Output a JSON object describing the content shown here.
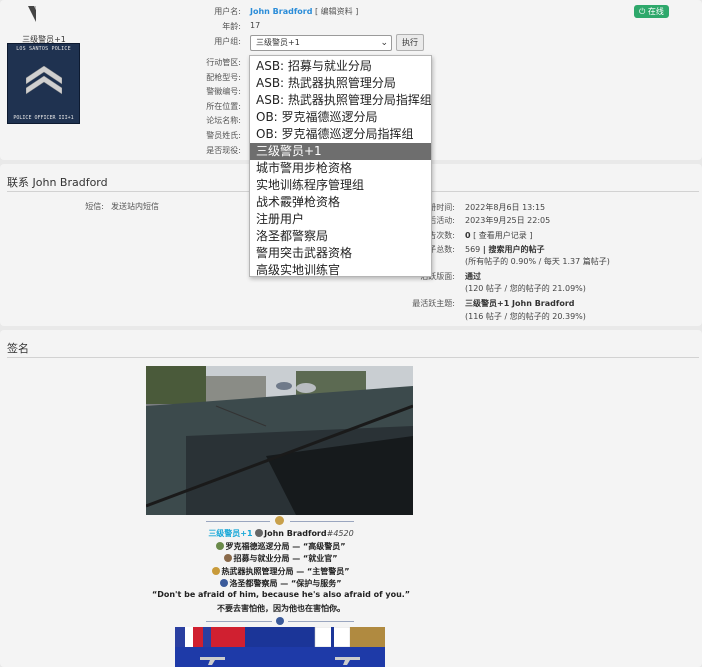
{
  "profile": {
    "avatar_rank": "三级警员+1",
    "avatar_badge_title": "LOS SANTOS POLICE",
    "avatar_badge_foot": "POLICE OFFICER III+1",
    "username_label": "用户名:",
    "username": "John Bradford",
    "edit_profile": "[ 编辑资料 ]",
    "age_label": "年龄:",
    "age": "17",
    "group_label": "用户组:",
    "group_selected": "三级警员+1",
    "execute_button": "执行",
    "online_status": "在线",
    "row_labels": [
      "行动管区:",
      "配枪型号:",
      "警徽编号:",
      "所在位置:",
      "论坛名称:",
      "警员姓氏:",
      "是否现役:"
    ]
  },
  "group_dropdown": {
    "options": [
      "ASB: 招募与就业分局",
      "ASB: 热武器执照管理分局",
      "ASB: 热武器执照管理分局指挥组",
      "OB: 罗克福德巡逻分局",
      "OB: 罗克福德巡逻分局指挥组",
      "三级警员+1",
      "城市警用步枪资格",
      "实地训练程序管理组",
      "战术霰弹枪资格",
      "注册用户",
      "洛圣都警察局",
      "警用突击武器资格",
      "高级实地训练官"
    ],
    "selected_index": 5
  },
  "contact": {
    "title": "联系 John Bradford",
    "pm_label": "短信:",
    "pm_link": "发送站内短信",
    "register_label": "册时间:",
    "register_value": "2022年8月6日 13:15",
    "last_active_label": "后活动:",
    "last_active_value": "2023年9月25日 22:05",
    "warnings_label": "告次数:",
    "warnings_count": "0",
    "warnings_link": "[ 查看用户记录 ]",
    "posts_label": "子总数:",
    "posts_count": "569",
    "posts_search": "| 搜索用户的帖子",
    "posts_stats": "(所有帖子的 0.90% / 每天 1.37 篇帖子)",
    "active_forum_label": "活跃版面:",
    "active_forum_value": "通过",
    "active_forum_stats": "(120 帖子 / 您的帖子的 21.09%)",
    "active_topic_label": "最活跃主题:",
    "active_topic_value": "三级警员+1 John Bradford",
    "active_topic_stats": "(116 帖子 / 您的帖子的 20.39%)"
  },
  "signature": {
    "title": "签名",
    "rank": "三级警员+1",
    "name": "John Bradford",
    "tag": "#4520",
    "line1": "罗克福德巡逻分局 — “高级警员”",
    "line2": "招募与就业分局 — “就业官”",
    "line3": "热武器执照管理分局 — “主管警员”",
    "line4": "洛圣都警察局 — “保护与服务”",
    "quote_en": "“Don't be afraid of him, because he's also afraid of you.”",
    "quote_cn": "不要去害怕他，因为他也在害怕你。"
  },
  "colors": {
    "link_blue": "#2a8cd8",
    "online_green": "#2ea86b",
    "rank_cyan": "#19a8d8",
    "selected_gray": "#6e6e6e"
  }
}
